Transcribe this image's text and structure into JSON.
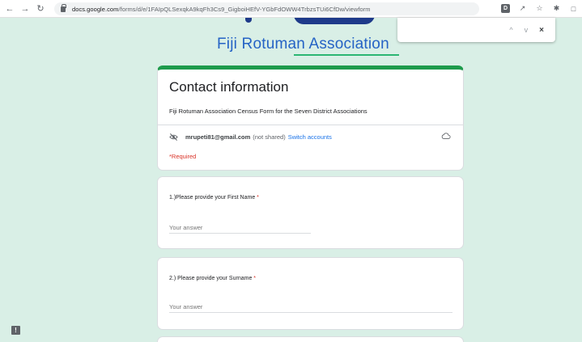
{
  "browser": {
    "url_domain": "docs.google.com",
    "url_path": "/forms/d/e/1FAIpQLSexqkA9kqFh3Cs9_GigboiHEfV-YGbFdOWW4TrbzsTUi6CfDw/viewform",
    "ext_badge": "D"
  },
  "find_bar": {
    "prev": "^",
    "next": "v",
    "close": "×"
  },
  "header": {
    "org_name": "Fiji Rotuman Association"
  },
  "form": {
    "title": "Contact information",
    "description": "Fiji Rotuman Association Census Form for the Seven District Associations",
    "account_email": "mrupeti81@gmail.com",
    "account_shared": "(not shared)",
    "switch_accounts": "Switch accounts",
    "required_note": "*Required"
  },
  "questions": [
    {
      "label": "1.)Please provide your  First Name",
      "required": "*",
      "placeholder": "Your answer"
    },
    {
      "label": "2.) Please provide your Surname",
      "required": "*",
      "placeholder": "Your answer"
    }
  ],
  "colors": {
    "accent": "#1e9b4c",
    "background": "#d9efe6",
    "required": "#d93025",
    "link": "#1a73e8"
  }
}
